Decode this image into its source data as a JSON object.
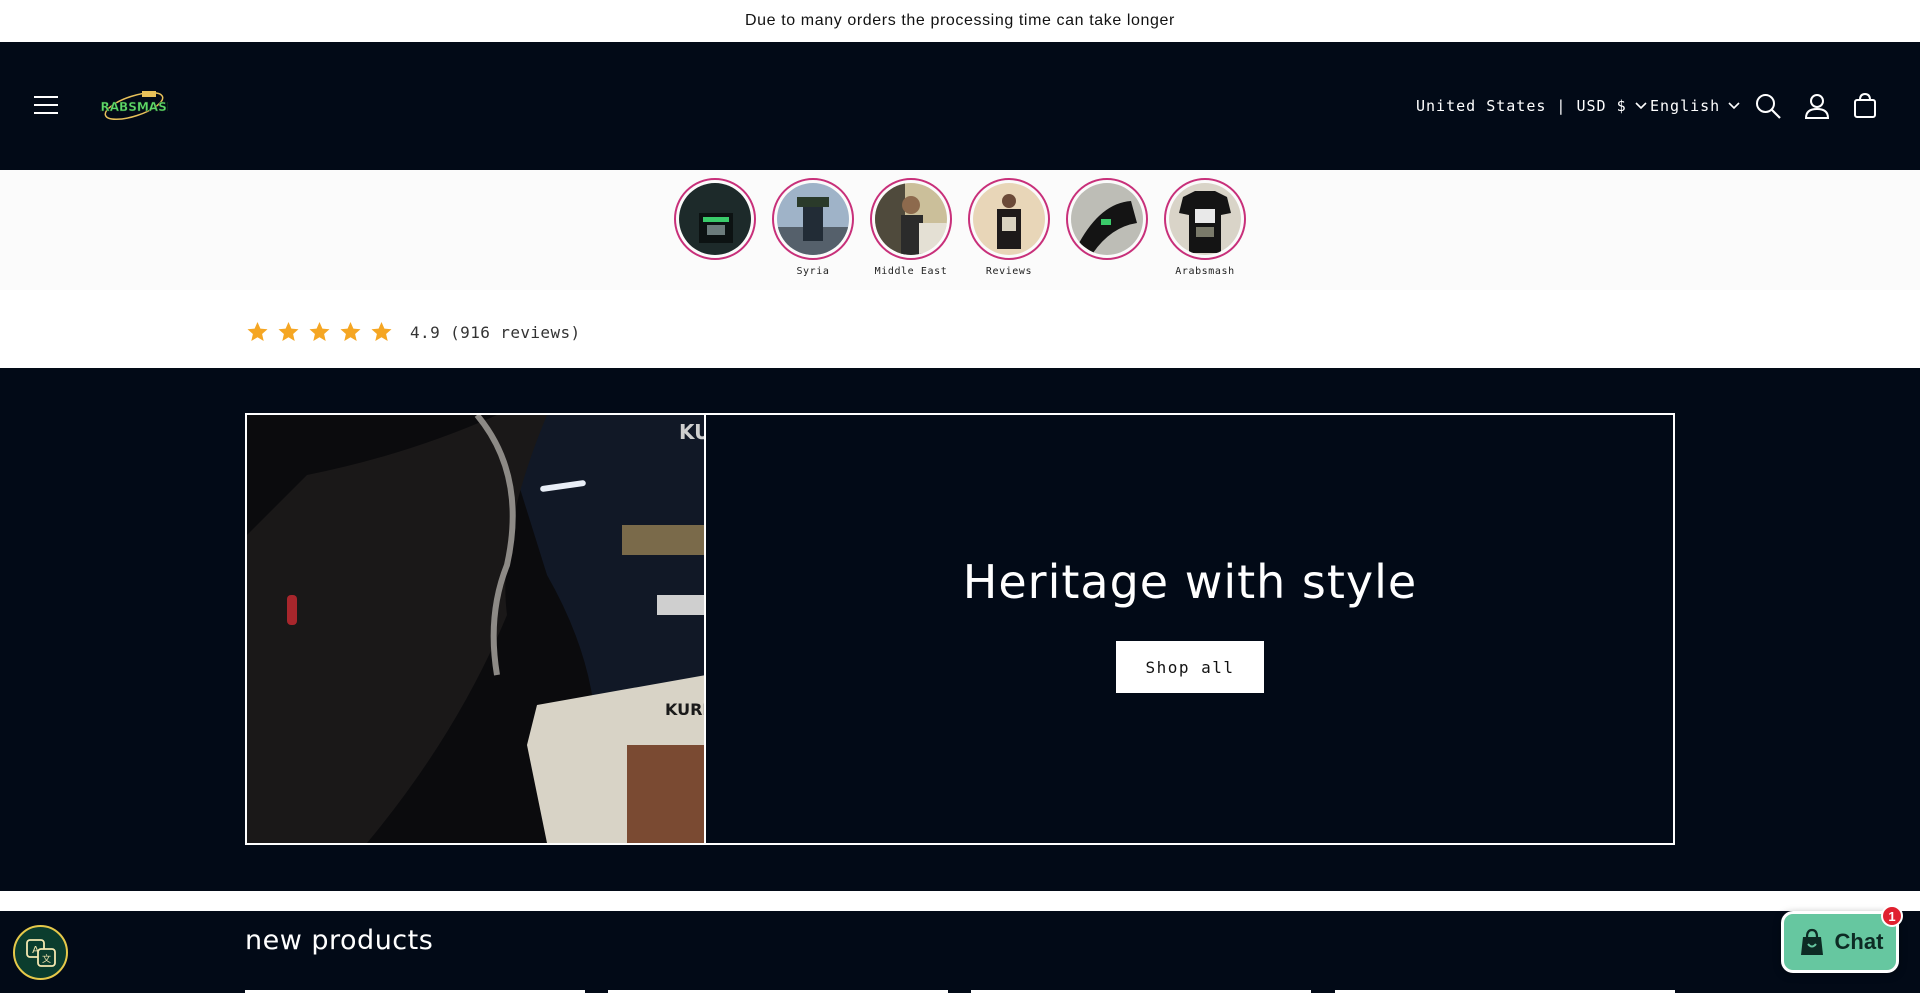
{
  "announcement": {
    "text": "Due to many orders the processing time can take longer"
  },
  "header": {
    "logo_text": "ARABSMASH",
    "country_selector": "United States | USD $",
    "language_selector": "English",
    "icons": [
      "menu-icon",
      "search-icon",
      "account-icon",
      "cart-icon"
    ]
  },
  "stories": [
    {
      "label": ""
    },
    {
      "label": "Syria"
    },
    {
      "label": "Middle East"
    },
    {
      "label": "Reviews"
    },
    {
      "label": ""
    },
    {
      "label": "Arabsmash"
    }
  ],
  "rating": {
    "stars": 5,
    "text": "4.9 (916 reviews)",
    "star_color": "#f5a623"
  },
  "hero": {
    "title": "Heritage with style",
    "button_label": "Shop all"
  },
  "products": {
    "title": "new products"
  },
  "chat": {
    "label": "Chat",
    "badge": "1"
  },
  "colors": {
    "dark_bg": "#020a17",
    "story_ring": "#c8307a",
    "chat_bg": "#66c7a0"
  }
}
